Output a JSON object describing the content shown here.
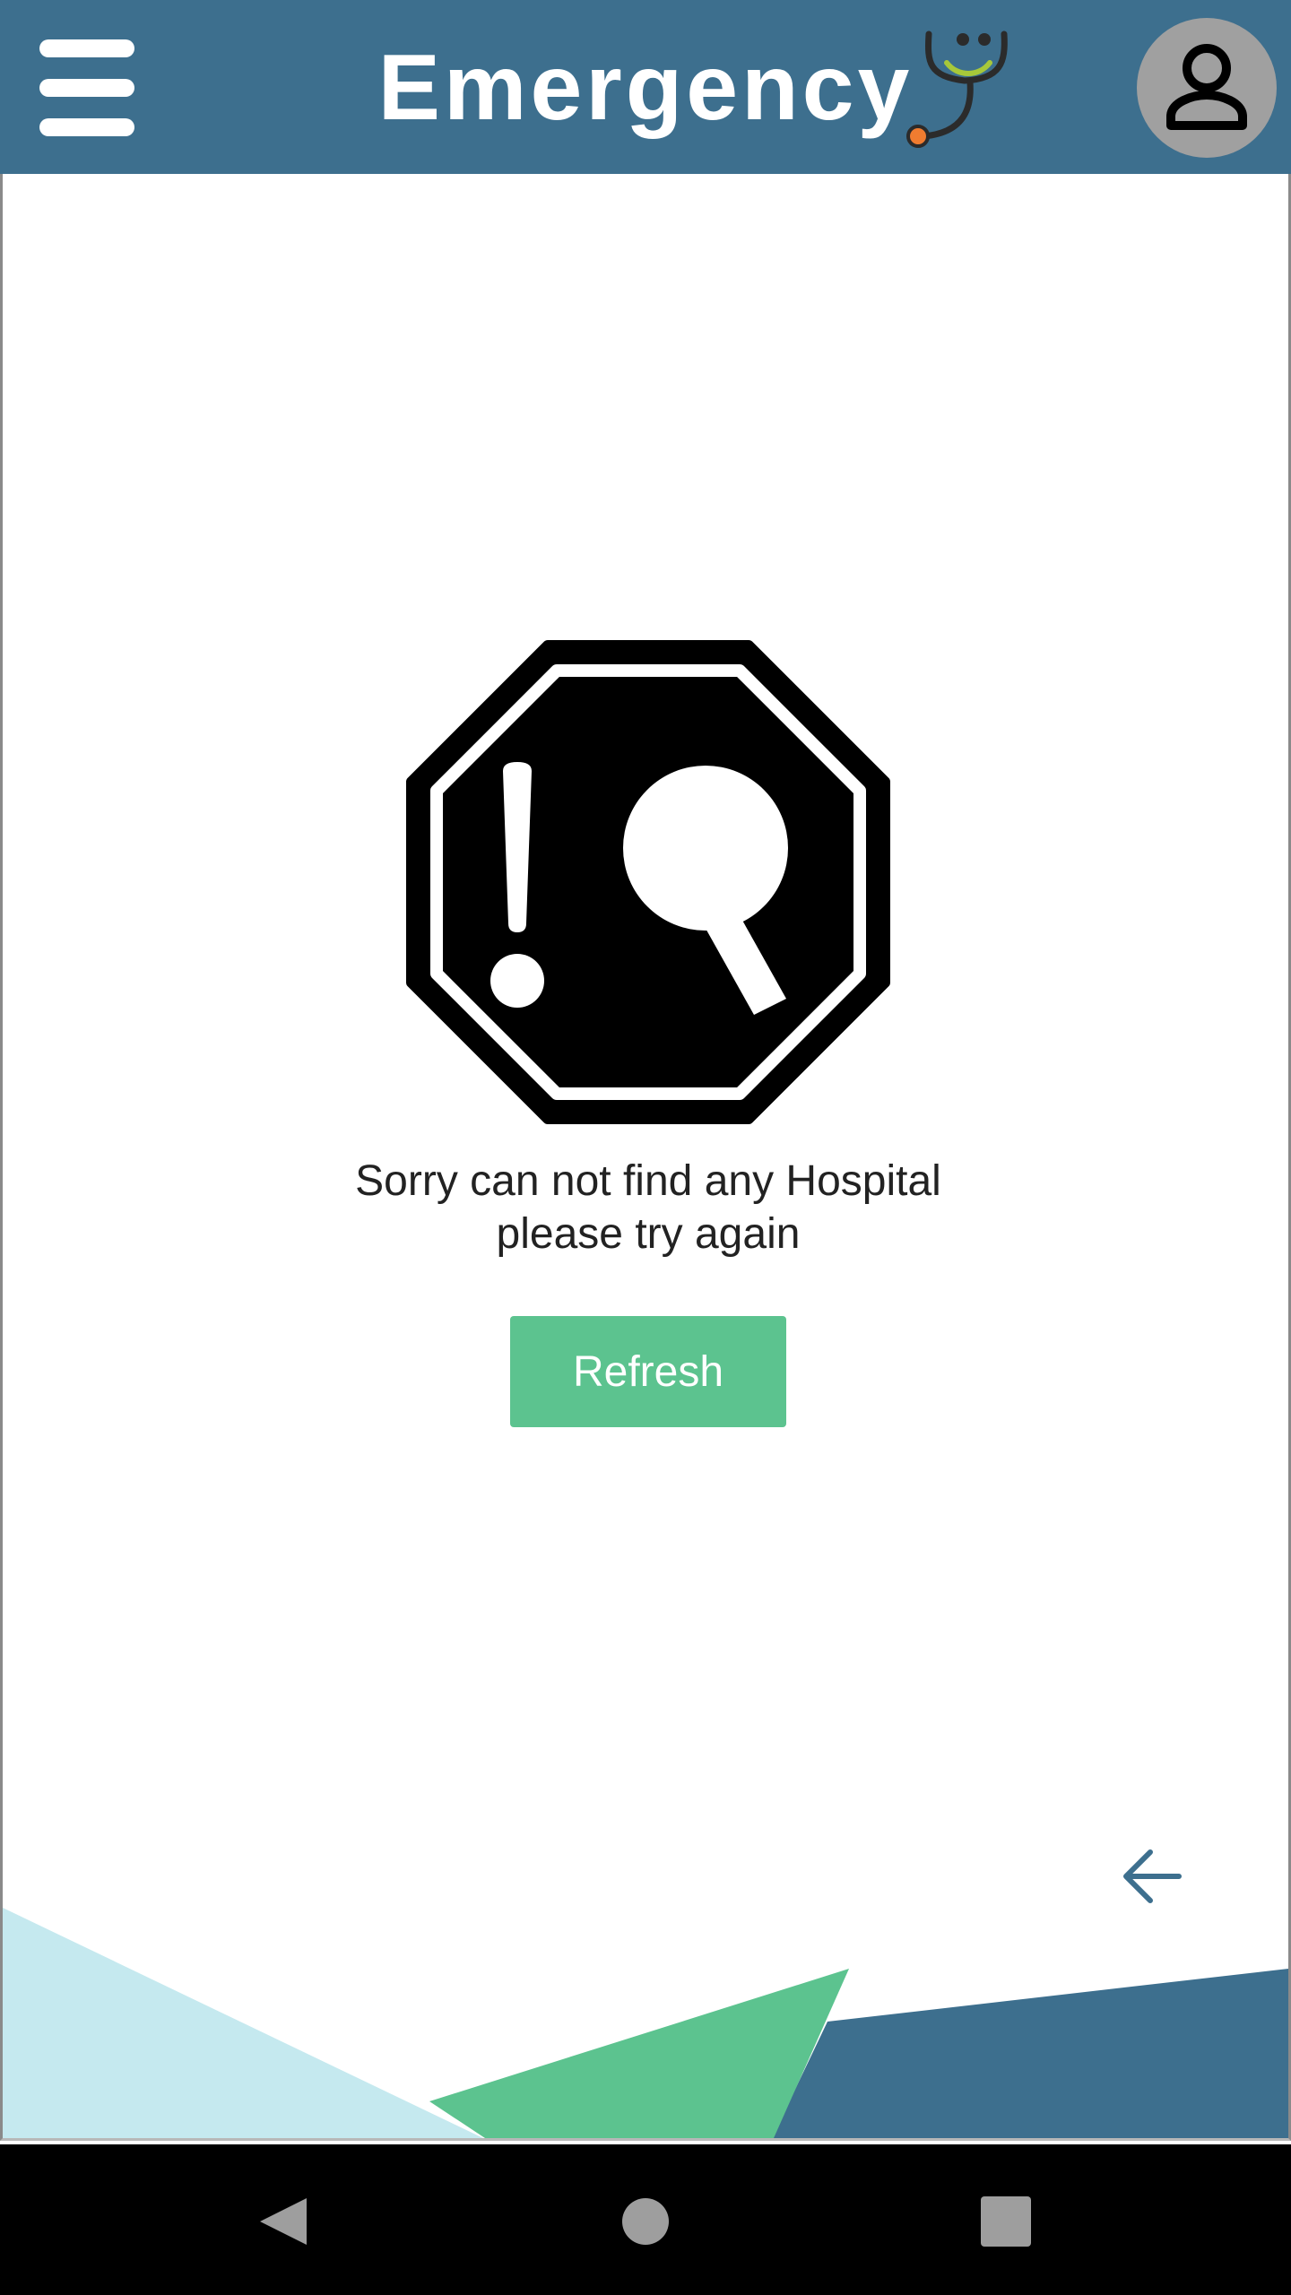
{
  "header": {
    "title": "Emergency"
  },
  "empty_state": {
    "message_line1": "Sorry can not find any Hospital",
    "message_line2": "please try again",
    "refresh_label": "Refresh"
  },
  "icons": {
    "menu": "hamburger-menu-icon",
    "logo": "stethoscope-smile-logo",
    "avatar": "person-icon",
    "empty": "search-alert-octagon-icon",
    "back": "arrow-left-icon",
    "nav_back": "triangle-back-icon",
    "nav_home": "circle-home-icon",
    "nav_recent": "square-recent-icon"
  },
  "colors": {
    "appbar": "#3d6f8e",
    "accent_green": "#5cc38f",
    "light_blue": "#c5e9ef",
    "avatar_bg": "#a0a0a0",
    "logo_orange": "#f07c30",
    "logo_green": "#a7c83a"
  }
}
